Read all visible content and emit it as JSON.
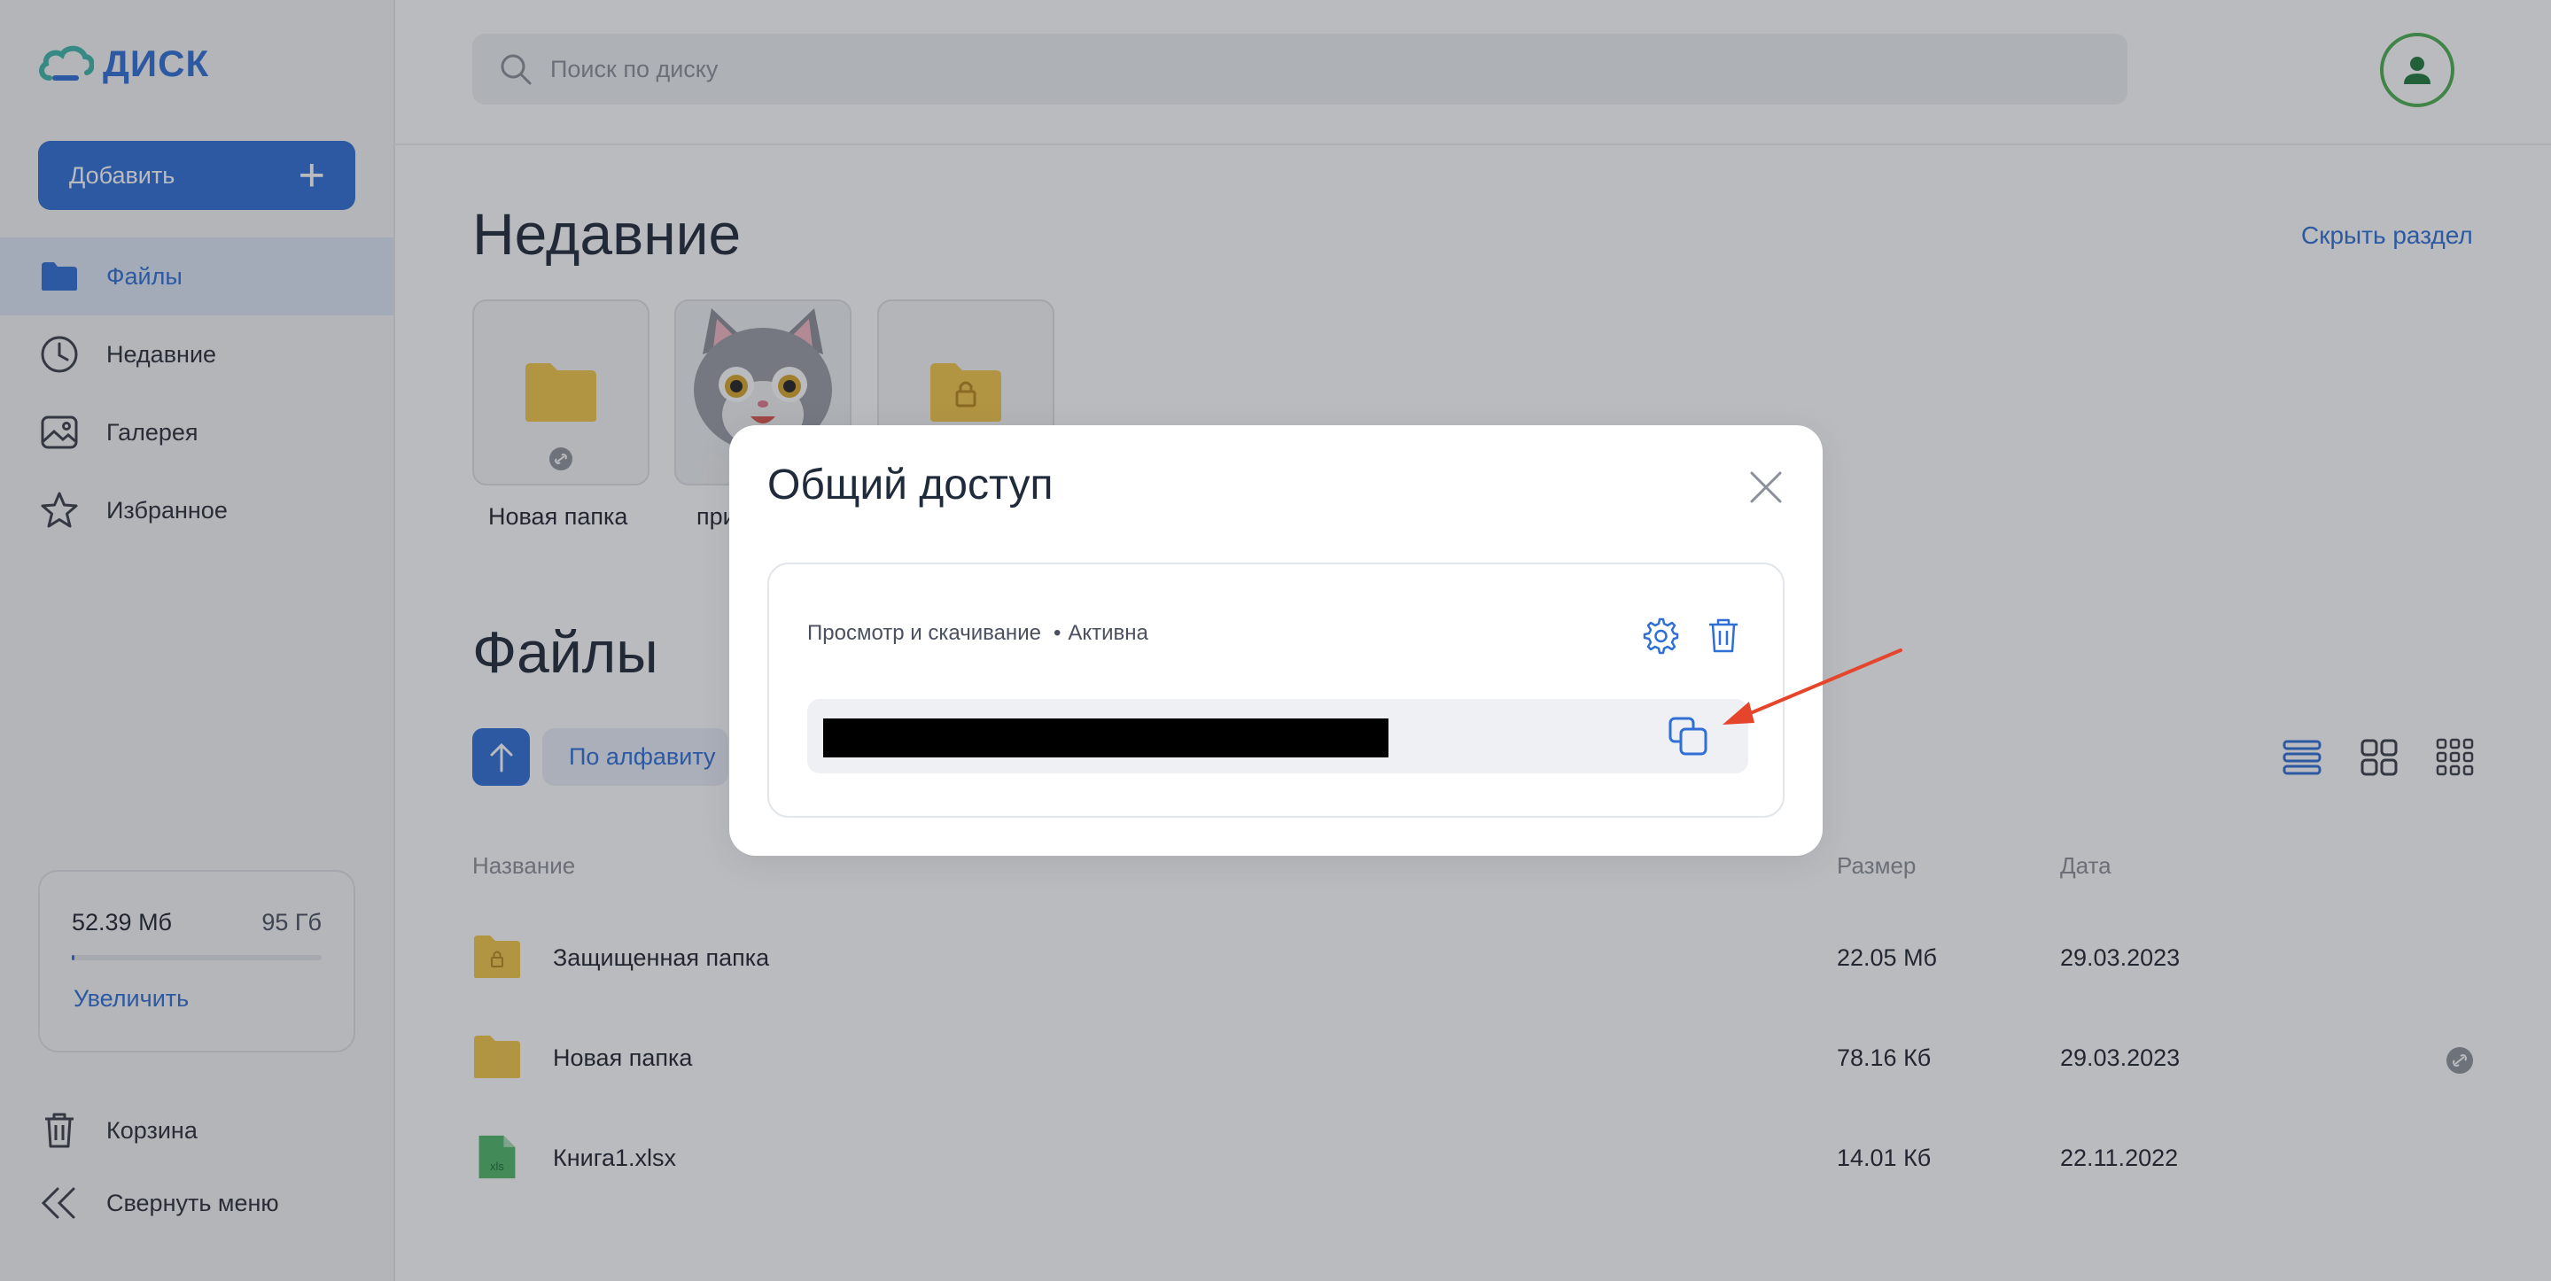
{
  "app": {
    "logo_text": "ДИСК"
  },
  "sidebar": {
    "add_label": "Добавить",
    "items": [
      {
        "label": "Файлы",
        "icon": "folder-icon",
        "active": true
      },
      {
        "label": "Недавние",
        "icon": "clock-icon"
      },
      {
        "label": "Галерея",
        "icon": "gallery-icon"
      },
      {
        "label": "Избранное",
        "icon": "star-icon"
      }
    ],
    "storage": {
      "used": "52.39 Мб",
      "total": "95 Гб",
      "increase_label": "Увеличить"
    },
    "trash_label": "Корзина",
    "collapse_label": "Свернуть меню"
  },
  "header": {
    "search_placeholder": "Поиск по диску"
  },
  "recent": {
    "title": "Недавние",
    "hide_label": "Скрыть раздел",
    "items": [
      {
        "label": "Новая папка",
        "kind": "folder-shared"
      },
      {
        "label": "при",
        "kind": "image-cat"
      },
      {
        "label": "",
        "kind": "folder-locked"
      }
    ]
  },
  "files": {
    "title": "Файлы",
    "sort_label": "По алфавиту",
    "columns": {
      "name": "Название",
      "size": "Размер",
      "date": "Дата"
    },
    "rows": [
      {
        "name": "Защищенная папка",
        "size": "22.05 Мб",
        "date": "29.03.2023",
        "icon": "folder-lock-icon",
        "shared": false
      },
      {
        "name": "Новая папка",
        "size": "78.16 Кб",
        "date": "29.03.2023",
        "icon": "folder-icon",
        "shared": true
      },
      {
        "name": "Книга1.xlsx",
        "size": "14.01 Кб",
        "date": "22.11.2022",
        "icon": "xls-file-icon",
        "shared": false
      }
    ]
  },
  "modal": {
    "title": "Общий доступ",
    "access_type": "Просмотр и скачивание",
    "status": "Активна",
    "link_value_redacted": true
  },
  "colors": {
    "accent": "#2f6fd6",
    "annotation_arrow": "#e5452a"
  }
}
